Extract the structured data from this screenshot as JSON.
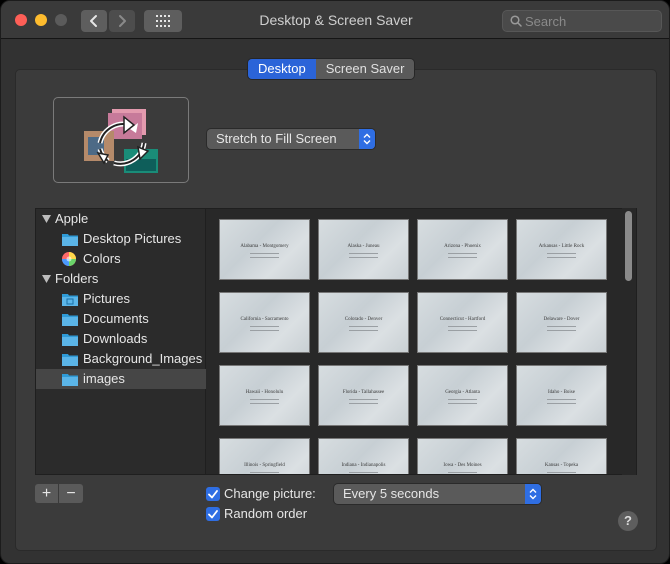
{
  "window": {
    "title": "Desktop & Screen Saver"
  },
  "search": {
    "placeholder": "Search"
  },
  "tabs": [
    {
      "label": "Desktop",
      "active": true
    },
    {
      "label": "Screen Saver",
      "active": false
    }
  ],
  "fill_mode": {
    "value": "Stretch to Fill Screen"
  },
  "sidebar": {
    "groups": [
      {
        "label": "Apple",
        "items": [
          {
            "label": "Desktop Pictures",
            "icon": "folder-icon"
          },
          {
            "label": "Colors",
            "icon": "color-wheel-icon"
          }
        ]
      },
      {
        "label": "Folders",
        "items": [
          {
            "label": "Pictures",
            "icon": "pictures-folder-icon"
          },
          {
            "label": "Documents",
            "icon": "folder-icon"
          },
          {
            "label": "Downloads",
            "icon": "folder-icon"
          },
          {
            "label": "Background_Images",
            "icon": "folder-icon"
          },
          {
            "label": "images",
            "icon": "folder-icon",
            "selected": true
          }
        ]
      }
    ]
  },
  "thumbnails": [
    "Alabama - Montgomery",
    "Alaska - Juneau",
    "Arizona - Phoenix",
    "Arkansas - Little Rock",
    "California - Sacramento",
    "Colorado - Denver",
    "Connecticut - Hartford",
    "Delaware - Dover",
    "Hawaii - Honolulu",
    "Florida - Tallahassee",
    "Georgia - Atlanta",
    "Idaho - Boise",
    "Illinois - Springfield",
    "Indiana - Indianapolis",
    "Iowa - Des Moines",
    "Kansas - Topeka"
  ],
  "bottom": {
    "add": "+",
    "remove": "−",
    "change_picture_label": "Change picture:",
    "change_picture_checked": true,
    "interval": "Every 5 seconds",
    "random_order_label": "Random order",
    "random_order_checked": true,
    "help": "?"
  },
  "colors": {
    "accent": "#2f6ee3",
    "tab_active": "#2b64d8",
    "window_bg": "#323232"
  }
}
